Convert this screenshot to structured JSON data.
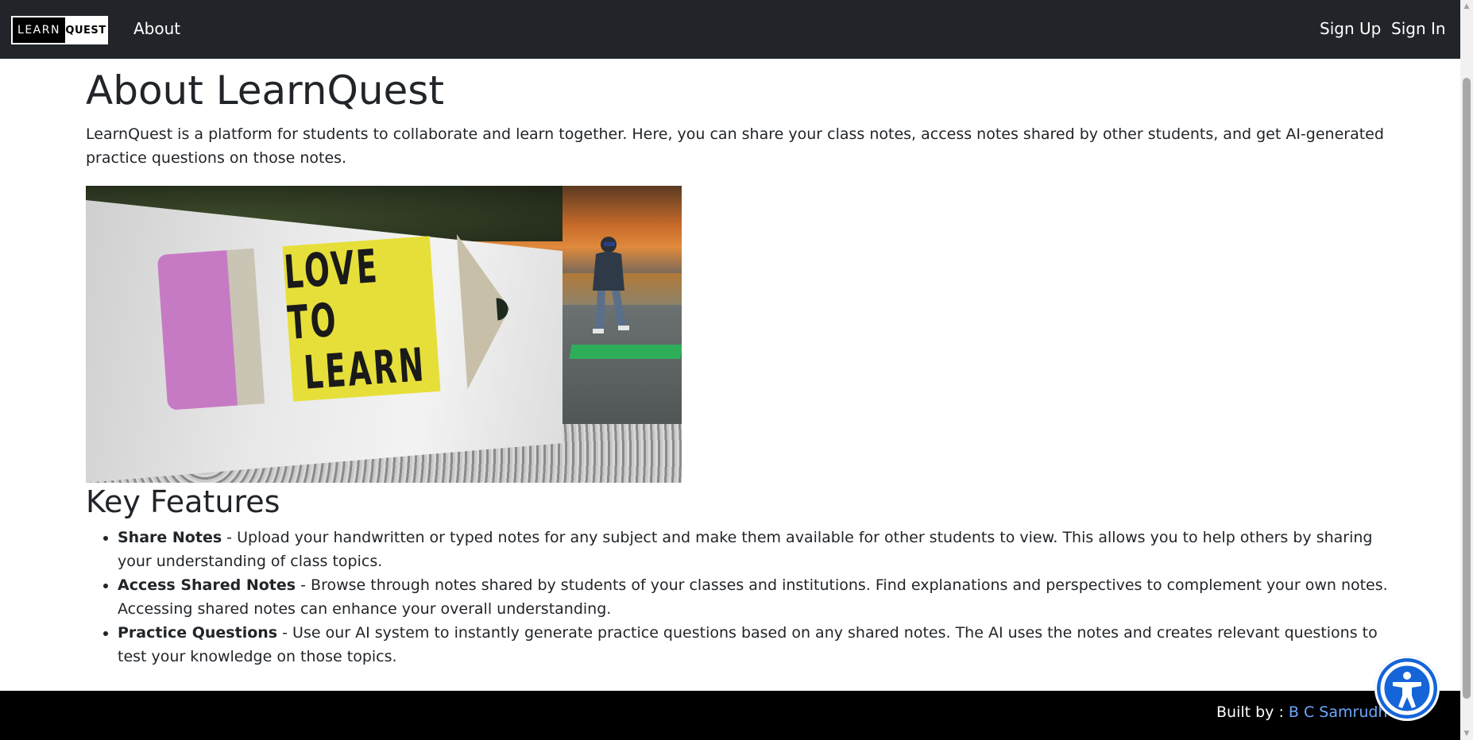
{
  "navbar": {
    "logo_left": "LEARN",
    "logo_right": "QUEST",
    "about": "About",
    "sign_up": "Sign Up",
    "sign_in": "Sign In"
  },
  "main": {
    "title": "About LearnQuest",
    "intro": "LearnQuest is a platform for students to collaborate and learn together. Here, you can share your class notes, access notes shared by other students, and get AI-generated practice questions on those notes.",
    "hero_image": {
      "sign_line1": "LOVE TO",
      "sign_line2": "LEARN"
    },
    "features_title": "Key Features",
    "features": [
      {
        "name": "Share Notes",
        "desc": " - Upload your handwritten or typed notes for any subject and make them available for other students to view. This allows you to help others by sharing your understanding of class topics."
      },
      {
        "name": "Access Shared Notes",
        "desc": " - Browse through notes shared by students of your classes and institutions. Find explanations and perspectives to complement your own notes. Accessing shared notes can enhance your overall understanding."
      },
      {
        "name": "Practice Questions",
        "desc": " - Use our AI system to instantly generate practice questions based on any shared notes. The AI uses the notes and creates relevant questions to test your knowledge on those topics."
      }
    ]
  },
  "footer": {
    "built_by_label": "Built by : ",
    "author": "B C Samrudh"
  },
  "colors": {
    "navbar_bg": "#212529",
    "footer_bg": "#000000",
    "link": "#6ea8fe",
    "accessibility_button": "#1565d8"
  },
  "icons": {
    "accessibility": "accessibility-icon"
  }
}
